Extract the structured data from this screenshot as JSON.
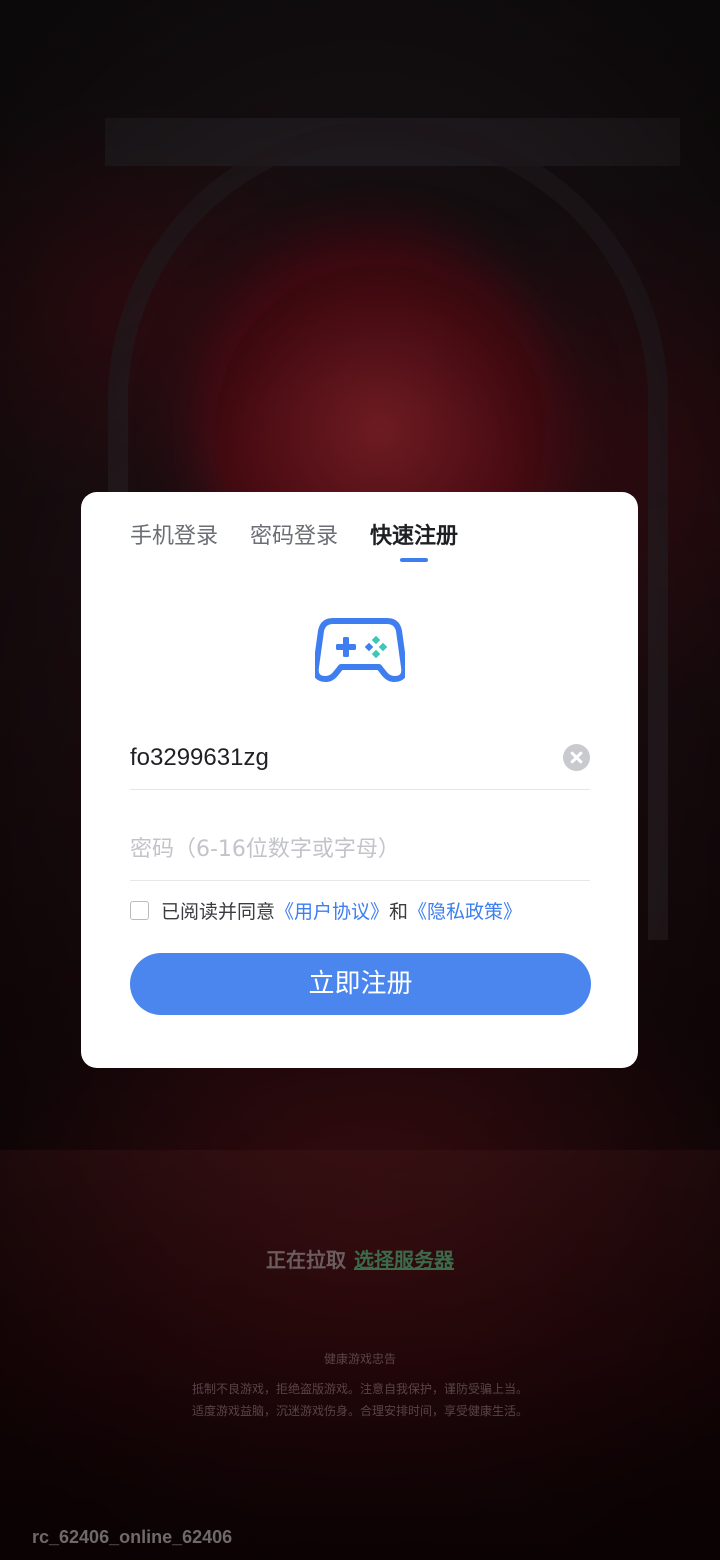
{
  "tabs": [
    {
      "label": "手机登录",
      "active": false
    },
    {
      "label": "密码登录",
      "active": false
    },
    {
      "label": "快速注册",
      "active": true
    }
  ],
  "logo_icon": "gamepad-icon",
  "account": {
    "value": "fo3299631zg"
  },
  "password": {
    "placeholder": "密码（6-16位数字或字母）"
  },
  "agreement": {
    "prefix": "已阅读并同意",
    "user_agreement": "《用户协议》",
    "and": "和",
    "privacy_policy": "《隐私政策》",
    "checked": false
  },
  "register_button": "立即注册",
  "server": {
    "status": "正在拉取",
    "link": "选择服务器"
  },
  "health_notice": {
    "title": "健康游戏忠告",
    "line1": "抵制不良游戏，拒绝盗版游戏。注意自我保护，谨防受骗上当。",
    "line2": "适度游戏益脑，沉迷游戏伤身。合理安排时间，享受健康生活。"
  },
  "version": "rc_62406_online_62406",
  "colors": {
    "accent": "#4a86ee",
    "link": "#3d7ef0",
    "logo_teal": "#3ec7b9"
  }
}
